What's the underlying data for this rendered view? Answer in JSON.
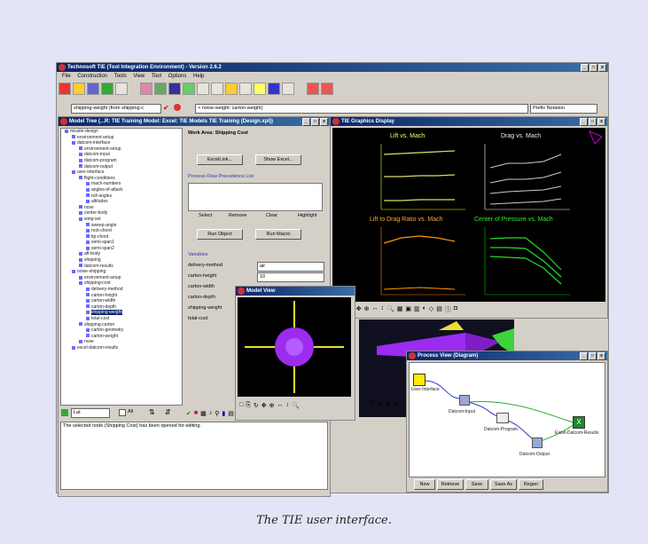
{
  "app": {
    "title": "Technosoft TIE (Tool Integration Environment) - Version 2.6.2"
  },
  "menu": [
    "File",
    "Construction",
    "Tools",
    "View",
    "Tool",
    "Options",
    "Help"
  ],
  "address": {
    "left": "shipping-weight (from shipping-c",
    "right": "> noise-weight: carton-weight)",
    "notation": "Prefix Notation"
  },
  "model_tree": {
    "title": "Model Tree (...R: TIE Training Model: Excel: TIE Models TIE Training (Design.xpl))",
    "items": [
      "missile-design",
      "environment-setup",
      "datcom-interface",
      "environment-setup",
      "datcom-input",
      "datcom-program",
      "datcom-output",
      "user-interface",
      "flight-conditions",
      "mach-numbers",
      "angles-of-attack",
      "roll-angles",
      "altitudes",
      "nose",
      "center-body",
      "wing-set",
      "sweep-angle",
      "root-chord",
      "tip-chord",
      "semi-span1",
      "semi-span2",
      "aft-body",
      "shipping",
      "datcom-results",
      "noise-shipping",
      "environment-setup",
      "shipping-cost",
      "delivery-method",
      "carton-height",
      "carton-width",
      "carton-depth",
      "shipping-weight",
      "total-cost",
      "shipping-carton",
      "carton-geometry",
      "carton-weight",
      "nose",
      "excel-datcom-results"
    ],
    "footer_select": "Lat",
    "footer_check": "All"
  },
  "work_area": {
    "title": "Work Area: Shipping Cost",
    "excel_link": "ExcelLink...",
    "show_excel": "Show Excel...",
    "ppl_label": "Process Flow Precedence List",
    "select": "Select",
    "remove": "Remove",
    "clear": "Clear",
    "highlight": "Highlight",
    "run_object": "Run Object",
    "run_macro": "Run Macro",
    "variables_label": "Variables",
    "vars": [
      {
        "name": "delivery-method",
        "value": "air"
      },
      {
        "name": "carton-height",
        "value": "10"
      },
      {
        "name": "carton-width",
        "value": ""
      },
      {
        "name": "carton-depth",
        "value": ""
      },
      {
        "name": "shipping-weight",
        "value": ""
      },
      {
        "name": "total-cost",
        "value": ""
      }
    ]
  },
  "status": {
    "message": "The selected node (Shipping Cost) has been opened for editing."
  },
  "graphics": {
    "title": "TIE Graphics Display",
    "plots": [
      "Lift vs. Mach",
      "Drag vs. Mach",
      "Lift to Drag Ratio vs. Mach",
      "Center of Pressure vs. Mach"
    ]
  },
  "small_view": {
    "title": "Model View"
  },
  "process_view": {
    "title": "Process View (Diagram)",
    "nodes": [
      "User-Interface",
      "Datcom-Input",
      "Datcom-Program",
      "Datcom-Output",
      "Excel-Datcom-Results"
    ],
    "buttons": [
      "New",
      "Retrieve",
      "Save",
      "Save As",
      "Regen"
    ]
  },
  "caption": "The TIE user interface.",
  "colors": {
    "title_bar": "#0a246a",
    "purple_body": "#9b2cf0",
    "yellow_wing": "#e8e030"
  }
}
